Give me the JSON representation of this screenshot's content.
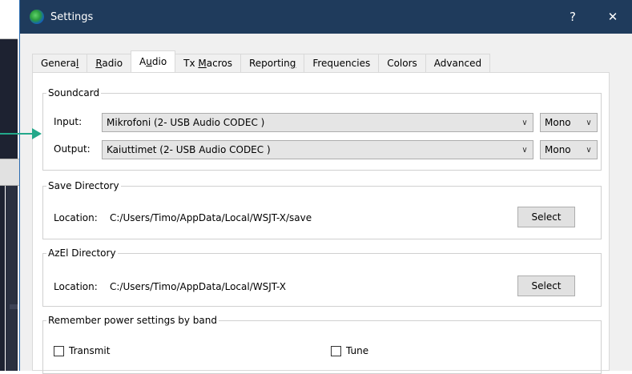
{
  "window": {
    "title": "Settings",
    "help_label": "?",
    "close_label": "✕"
  },
  "tabs": [
    {
      "label": "General",
      "underline": "l"
    },
    {
      "label": "Radio",
      "underline": "R"
    },
    {
      "label": "Audio",
      "underline": "u"
    },
    {
      "label": "Tx Macros",
      "underline": "M"
    },
    {
      "label": "Reporting",
      "underline": "g"
    },
    {
      "label": "Frequencies"
    },
    {
      "label": "Colors"
    },
    {
      "label": "Advanced"
    }
  ],
  "active_tab": "Audio",
  "soundcard": {
    "title": "Soundcard",
    "input_label": "Input:",
    "input_value": "Mikrofoni (2- USB Audio CODEC )",
    "input_channel": "Mono",
    "output_label": "Output:",
    "output_value": "Kaiuttimet (2- USB Audio CODEC )",
    "output_channel": "Mono"
  },
  "save_directory": {
    "title": "Save Directory",
    "location_label": "Location:",
    "location_value": "C:/Users/Timo/AppData/Local/WSJT-X/save",
    "select_label": "Select"
  },
  "azel_directory": {
    "title": "AzEl Directory",
    "location_label": "Location:",
    "location_value": "C:/Users/Timo/AppData/Local/WSJT-X",
    "select_label": "Select"
  },
  "power_settings": {
    "title": "Remember power settings by band",
    "transmit_label": "Transmit",
    "tune_label": "Tune"
  },
  "colors": {
    "titlebar": "#1f3b5c",
    "annotation_arrow": "#23a88a"
  },
  "icons": {
    "app": "globe-icon",
    "chevron": "chevron-down-icon"
  }
}
